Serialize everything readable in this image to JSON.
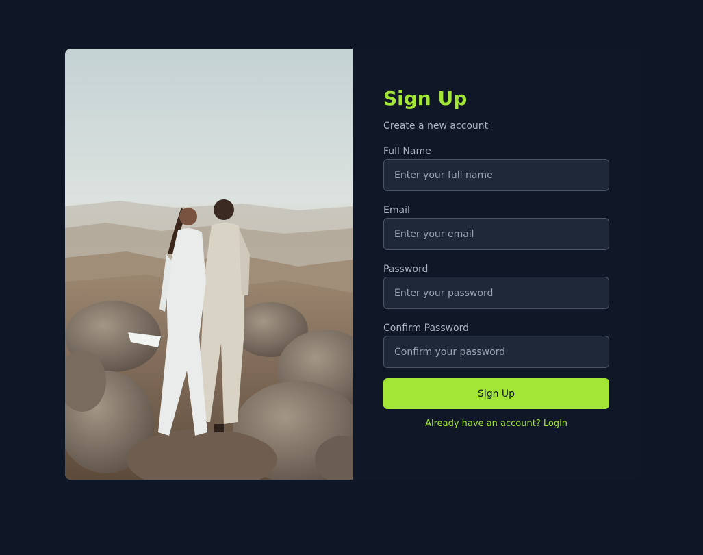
{
  "theme": {
    "background": "#0f1726",
    "accent": "#a3e635",
    "input_bg": "#1e2838",
    "input_border": "#4b5565",
    "muted_text": "#aab3c2"
  },
  "hero_image": {
    "icon": "couple-photo"
  },
  "form": {
    "title": "Sign Up",
    "subtitle": "Create a new account",
    "fields": [
      {
        "label": "Full Name",
        "placeholder": "Enter your full name",
        "value": ""
      },
      {
        "label": "Email",
        "placeholder": "Enter your email",
        "value": ""
      },
      {
        "label": "Password",
        "placeholder": "Enter your password",
        "value": ""
      },
      {
        "label": "Confirm Password",
        "placeholder": "Confirm your password",
        "value": ""
      }
    ],
    "submit_label": "Sign Up",
    "login_prompt": "Already have an account? Login"
  }
}
